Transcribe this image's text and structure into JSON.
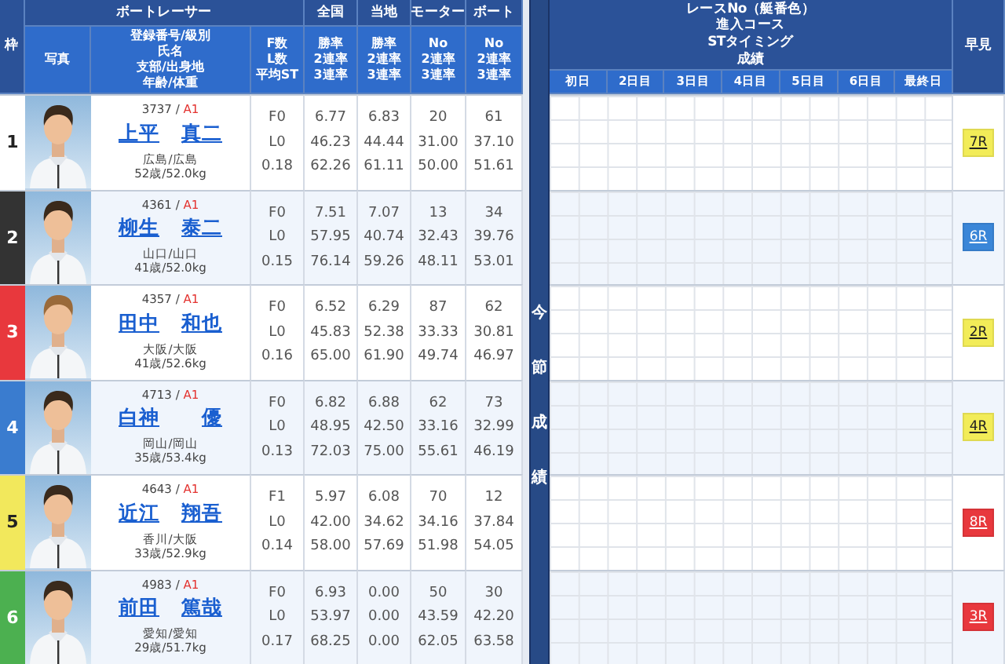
{
  "header": {
    "frame": "枠",
    "racer": "ボートレーサー",
    "national": "全国",
    "local": "当地",
    "motor": "モーター",
    "boat": "ボート",
    "photo": "写真",
    "info": [
      "登録番号/級別",
      "氏名",
      "支部/出身地",
      "年齢/体重"
    ],
    "fl": [
      "F数",
      "L数",
      "平均ST"
    ],
    "national_sub": [
      "勝率",
      "2連率",
      "3連率"
    ],
    "local_sub": [
      "勝率",
      "2連率",
      "3連率"
    ],
    "motor_sub": [
      "No",
      "2連率",
      "3連率"
    ],
    "boat_sub": [
      "No",
      "2連率",
      "3連率"
    ],
    "series": "今節成績",
    "race": [
      "レースNo（艇番色）",
      "進入コース",
      "STタイミング",
      "成績"
    ],
    "days": [
      "初日",
      "2日目",
      "3日目",
      "4日目",
      "5日目",
      "6日目",
      "最終日"
    ],
    "quick": "早見"
  },
  "racers": [
    {
      "frame": "1",
      "color": "#ffffff",
      "id": "3737 /",
      "class": "A1",
      "family": "上平",
      "given": "真二",
      "branch": "広島/広島",
      "age_weight": "52歳/52.0kg",
      "fl": [
        "F0",
        "L0",
        "0.18"
      ],
      "national": [
        "6.77",
        "46.23",
        "62.26"
      ],
      "local": [
        "6.83",
        "44.44",
        "61.11"
      ],
      "motor": [
        "20",
        "31.00",
        "50.00"
      ],
      "boat": [
        "61",
        "37.10",
        "51.61"
      ],
      "quick": {
        "label": "7R",
        "color": "#f2ec58"
      }
    },
    {
      "frame": "2",
      "color": "#333333",
      "id": "4361 /",
      "class": "A1",
      "family": "柳生",
      "given": "泰二",
      "branch": "山口/山口",
      "age_weight": "41歳/52.0kg",
      "fl": [
        "F0",
        "L0",
        "0.15"
      ],
      "national": [
        "7.51",
        "57.95",
        "76.14"
      ],
      "local": [
        "7.07",
        "40.74",
        "59.26"
      ],
      "motor": [
        "13",
        "32.43",
        "48.11"
      ],
      "boat": [
        "34",
        "39.76",
        "53.01"
      ],
      "quick": {
        "label": "6R",
        "color": "#3a86d8"
      }
    },
    {
      "frame": "3",
      "color": "#e8383d",
      "id": "4357 /",
      "class": "A1",
      "family": "田中",
      "given": "和也",
      "branch": "大阪/大阪",
      "age_weight": "41歳/52.6kg",
      "fl": [
        "F0",
        "L0",
        "0.16"
      ],
      "national": [
        "6.52",
        "45.83",
        "65.00"
      ],
      "local": [
        "6.29",
        "52.38",
        "61.90"
      ],
      "motor": [
        "87",
        "33.33",
        "49.74"
      ],
      "boat": [
        "62",
        "30.81",
        "46.97"
      ],
      "quick": {
        "label": "2R",
        "color": "#f2ec58"
      }
    },
    {
      "frame": "4",
      "color": "#3a7ccf",
      "id": "4713 /",
      "class": "A1",
      "family": "白神",
      "given": "優",
      "branch": "岡山/岡山",
      "age_weight": "35歳/53.4kg",
      "fl": [
        "F0",
        "L0",
        "0.13"
      ],
      "national": [
        "6.82",
        "48.95",
        "72.03"
      ],
      "local": [
        "6.88",
        "42.50",
        "75.00"
      ],
      "motor": [
        "62",
        "33.16",
        "55.61"
      ],
      "boat": [
        "73",
        "32.99",
        "46.19"
      ],
      "quick": {
        "label": "4R",
        "color": "#f2ec58"
      }
    },
    {
      "frame": "5",
      "color": "#f2e85c",
      "id": "4643 /",
      "class": "A1",
      "family": "近江",
      "given": "翔吾",
      "branch": "香川/大阪",
      "age_weight": "33歳/52.9kg",
      "fl": [
        "F1",
        "L0",
        "0.14"
      ],
      "national": [
        "5.97",
        "42.00",
        "58.00"
      ],
      "local": [
        "6.08",
        "34.62",
        "57.69"
      ],
      "motor": [
        "70",
        "34.16",
        "51.98"
      ],
      "boat": [
        "12",
        "37.84",
        "54.05"
      ],
      "quick": {
        "label": "8R",
        "color": "#e8383d"
      }
    },
    {
      "frame": "6",
      "color": "#4cb050",
      "id": "4983 /",
      "class": "A1",
      "family": "前田",
      "given": "篤哉",
      "branch": "愛知/愛知",
      "age_weight": "29歳/51.7kg",
      "fl": [
        "F0",
        "L0",
        "0.17"
      ],
      "national": [
        "6.93",
        "53.97",
        "68.25"
      ],
      "local": [
        "0.00",
        "0.00",
        "0.00"
      ],
      "motor": [
        "50",
        "43.59",
        "62.05"
      ],
      "boat": [
        "30",
        "42.20",
        "63.58"
      ],
      "quick": {
        "label": "3R",
        "color": "#e8383d"
      }
    }
  ]
}
